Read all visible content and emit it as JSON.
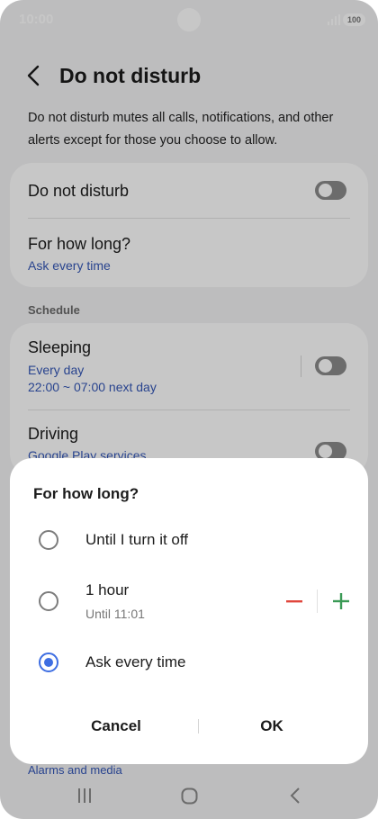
{
  "status_bar": {
    "time": "10:00",
    "battery": "100"
  },
  "header": {
    "title": "Do not disturb"
  },
  "description": "Do not disturb mutes all calls, notifications, and other alerts except for those you choose to allow.",
  "main_card": {
    "toggle_label": "Do not disturb",
    "toggle_on": false,
    "duration_label": "For how long?",
    "duration_value": "Ask every time"
  },
  "schedule": {
    "section_label": "Schedule",
    "items": [
      {
        "label": "Sleeping",
        "days": "Every day",
        "time": "22:00 ~ 07:00 next day",
        "enabled": false
      },
      {
        "label": "Driving",
        "source": "Google Play services",
        "enabled": false
      }
    ]
  },
  "below_dialog_text": "Alarms and media",
  "dialog": {
    "title": "For how long?",
    "options": [
      {
        "label": "Until I turn it off",
        "selected": false
      },
      {
        "label": "1 hour",
        "sub": "Until 11:01",
        "selected": false
      },
      {
        "label": "Ask every time",
        "selected": true
      }
    ],
    "cancel_label": "Cancel",
    "ok_label": "OK"
  },
  "colors": {
    "accent": "#3e6ee2",
    "link": "#3457b7",
    "minus": "#e0463c",
    "plus": "#3a9a55"
  },
  "icons": {
    "back": "chevron-left-icon",
    "minus": "minus-icon",
    "plus": "plus-icon",
    "nav_recents": "recents-icon",
    "nav_home": "home-icon",
    "nav_back": "back-icon"
  }
}
